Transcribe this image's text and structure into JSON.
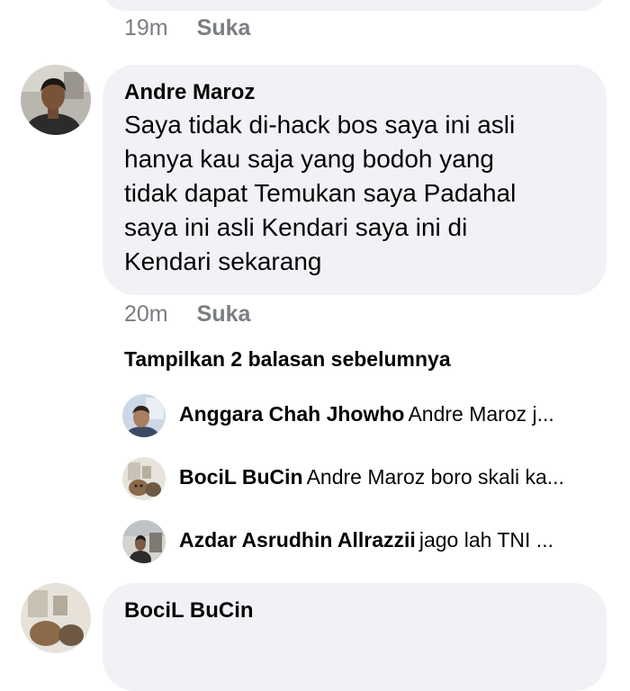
{
  "top_comment": {
    "time": "19m",
    "like_label": "Suka"
  },
  "main_comment": {
    "author": "Andre Maroz",
    "text": "Saya tidak di-hack  bos saya ini asli\nhanya kau saja yang bodoh yang\ntidak dapat Temukan saya Padahal\nsaya ini asli Kendari saya ini di\nKendari sekarang",
    "time": "20m",
    "like_label": "Suka"
  },
  "previous_replies_label": "Tampilkan 2 balasan sebelumnya",
  "replies": [
    {
      "author": "Anggara Chah Jhowho",
      "snippet": "Andre Maroz  j..."
    },
    {
      "author": "BociL BuCin",
      "snippet": "Andre Maroz boro skali ka..."
    },
    {
      "author": "Azdar Asrudhin Allrazzii",
      "snippet": "jago lah TNI ..."
    }
  ],
  "next_comment": {
    "author": "BociL BuCin"
  }
}
